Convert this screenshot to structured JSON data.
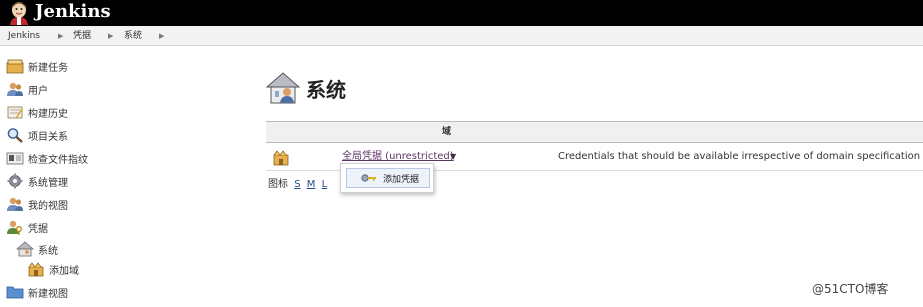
{
  "header": {
    "brand": "Jenkins"
  },
  "breadcrumb": {
    "items": [
      "Jenkins",
      "凭据",
      "系统"
    ]
  },
  "sidebar": {
    "items": [
      {
        "label": "新建任务",
        "icon": "new-task-icon"
      },
      {
        "label": "用户",
        "icon": "users-icon"
      },
      {
        "label": "构建历史",
        "icon": "build-history-icon"
      },
      {
        "label": "项目关系",
        "icon": "search-icon"
      },
      {
        "label": "检查文件指纹",
        "icon": "fingerprint-icon"
      },
      {
        "label": "系统管理",
        "icon": "gear-icon"
      },
      {
        "label": "我的视图",
        "icon": "my-views-icon"
      },
      {
        "label": "凭据",
        "icon": "credentials-icon"
      }
    ],
    "sub_items": [
      {
        "label": "系统",
        "icon": "system-house-icon"
      },
      {
        "label": "添加域",
        "icon": "add-domain-icon"
      }
    ],
    "last_item": {
      "label": "新建视图",
      "icon": "folder-icon"
    }
  },
  "main": {
    "title": "系统",
    "table": {
      "header": "域",
      "rows": [
        {
          "store": "全局凭据 (unrestricted)",
          "description": "Credentials that should be available irrespective of domain specification to requi"
        }
      ]
    },
    "icon_size": {
      "label": "图标",
      "sizes": [
        "S",
        "M",
        "L"
      ]
    },
    "dropdown": {
      "item": "添加凭据"
    }
  },
  "watermark": "@51CTO博客",
  "colors": {
    "header_bg": "#000000",
    "breadcrumb_bg": "#f2f2f2",
    "link": "#5c3566",
    "table_header_bg": "#f0f0f0"
  }
}
